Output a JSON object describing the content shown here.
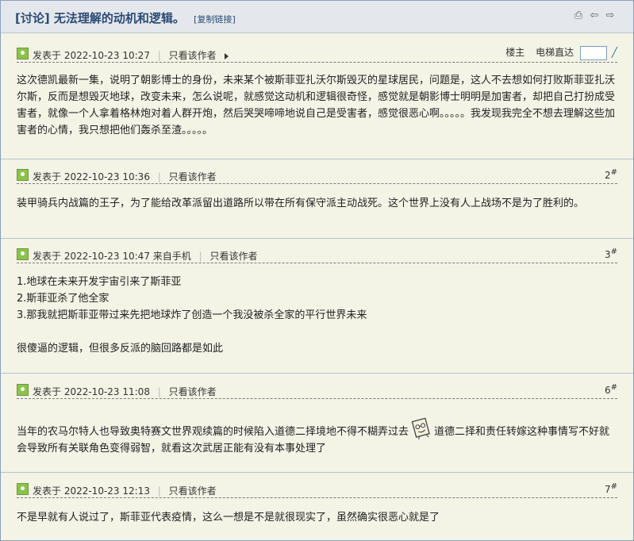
{
  "header": {
    "title": "[讨论] 无法理解的动机和逻辑。",
    "copy_link": "[复制链接]"
  },
  "post1": {
    "meta": "发表于 2022-10-23 10:27",
    "author_only": "只看该作者",
    "floor_label": "楼主",
    "jump_label": "电梯直达",
    "body": "这次德凯最新一集，说明了朝影博士的身份，未来某个被斯菲亚扎沃尔斯毁灭的星球居民，问题是，这人不去想如何打败斯菲亚扎沃尔斯，反而是想毁灭地球，改变未来，怎么说呢，就感觉这动机和逻辑很奇怪，感觉就是朝影博士明明是加害者，却把自己打扮成受害者，就像一个人拿着格林炮对着人群开炮，然后哭哭啼啼地说自己是受害者，感觉很恶心啊。。。。。我发现我完全不想去理解这些加害者的心情，我只想把他们轰杀至渣。。。。。"
  },
  "post2": {
    "meta": "发表于 2022-10-23 10:36",
    "author_only": "只看该作者",
    "floor_num": "2",
    "floor_mark": "#",
    "body": "装甲骑兵内战篇的王子，为了能给改革派留出道路所以带在所有保守派主动战死。这个世界上没有人上战场不是为了胜利的。"
  },
  "post3": {
    "meta": "发表于 2022-10-23 10:47 来自手机",
    "author_only": "只看该作者",
    "floor_num": "3",
    "floor_mark": "#",
    "line1": "1.地球在未来开发宇宙引来了斯菲亚",
    "line2": "2.斯菲亚杀了他全家",
    "line3": "3.那我就把斯菲亚带过来先把地球炸了创造一个我没被杀全家的平行世界未来",
    "line4": "很傻逼的逻辑，但很多反派的脑回路都是如此"
  },
  "post6": {
    "meta": "发表于 2022-10-23 11:08",
    "author_only": "只看该作者",
    "floor_num": "6",
    "floor_mark": "#",
    "body_a": "当年的农马尔特人也导致奥特赛文世界观续篇的时候陷入道德二择境地不得不糊弄过去",
    "body_b": "道德二择和责任转嫁这种事情写不好就会导致所有关联角色变得弱智，就看这次武居正能有没有本事处理了"
  },
  "post7": {
    "meta": "发表于 2022-10-23 12:13",
    "author_only": "只看该作者",
    "floor_num": "7",
    "floor_mark": "#",
    "body": "不是早就有人说过了，斯菲亚代表疫情，这么一想是不是就很现实了，虽然确实很恶心就是了"
  }
}
